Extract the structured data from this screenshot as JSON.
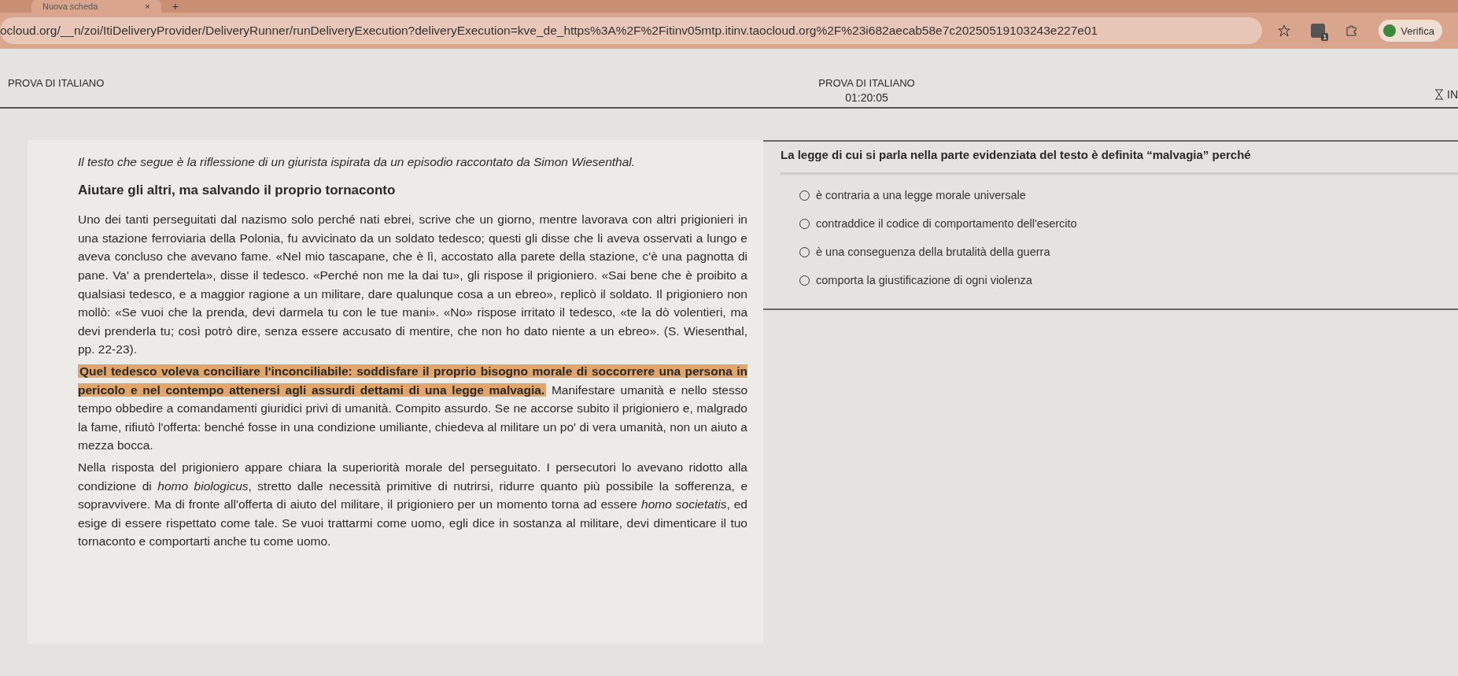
{
  "browser": {
    "tab_title": "Nuova scheda",
    "tab_close": "×",
    "new_tab": "+",
    "url": "ocloud.org/__n/zoi/ItiDeliveryProvider/DeliveryRunner/runDeliveryExecution?deliveryExecution=kve_de_https%3A%2F%2Fitinv05mtp.itinv.taocloud.org%2F%23i682aecab58e7c20250519103243e227e01",
    "extension_badge": "1",
    "verify_button": "Verifica"
  },
  "header": {
    "title": "PROVA DI ITALIANO",
    "test_name": "PROVA DI ITALIANO",
    "timer": "01:20:05",
    "user": "IN"
  },
  "passage": {
    "intro": "Il testo che segue è la riflessione di un giurista ispirata da un episodio raccontato da Simon Wiesenthal.",
    "heading": "Aiutare gli altri, ma salvando il proprio tornaconto",
    "paragraphs": [
      [
        {
          "text": "Uno dei tanti perseguitati dal nazismo solo perché nati ebrei, scrive che un giorno, mentre lavorava con altri prigionieri in una stazione ferroviaria della Polonia, fu avvicinato da un soldato tedesco; questi gli disse che li aveva osservati a lungo e aveva concluso che avevano fame. «Nel mio tascapane, che è lì, accostato alla parete della stazione, c'è una pagnotta di pane. Va' a prendertela», disse il tedesco. «Perché non me la dai tu», gli rispose il prigioniero. «Sai bene che è proibito a qualsiasi tedesco, e a maggior ragione a un militare, dare qualunque cosa a un ebreo», replicò il soldato. Il prigioniero non mollò: «Se vuoi che la prenda, devi darmela tu con le tue mani». «No» rispose irritato il tedesco, «te la dò volentieri, ma devi prenderla tu; così potrò dire, senza essere accusato di mentire, che non ho dato niente a un ebreo». (S. Wiesenthal, pp. 22-23).",
          "highlighted": false
        }
      ],
      [
        {
          "text": "Quel tedesco voleva conciliare l'inconciliabile: soddisfare il proprio bisogno morale di soccorrere una persona in pericolo e nel contempo attenersi agli assurdi dettami di una legge malvagia.",
          "highlighted": true
        },
        {
          "text": " Manifestare umanità e nello stesso tempo obbedire a comandamenti giuridici privi di umanità. Compito assurdo. Se ne accorse subito il prigioniero e, malgrado la fame, rifiutò l'offerta: benché fosse in una condizione umiliante, chiedeva al militare un po' di vera umanità, non un aiuto a mezza bocca.",
          "highlighted": false
        }
      ],
      [
        {
          "text": "Nella risposta del prigioniero appare chiara la superiorità morale del perseguitato. I persecutori lo avevano ridotto alla condizione di *homo biologicus*, stretto dalle necessità primitive di nutrirsi, ridurre quanto più possibile la sofferenza, e sopravvivere. Ma di fronte all'offerta di aiuto del militare, il prigioniero per un momento torna ad essere *homo societatis*, ed esige di essere rispettato come tale. Se vuoi trattarmi come uomo, egli dice in sostanza al militare, devi dimenticare il tuo tornaconto e comportarti anche tu come uomo.",
          "highlighted": false
        }
      ]
    ]
  },
  "question": {
    "prompt": "La legge di cui si parla nella parte evidenziata del testo è definita “malvagia” perché",
    "options": [
      {
        "label": "è contraria a una legge morale universale",
        "selected": false
      },
      {
        "label": "contraddice il codice di comportamento dell'esercito",
        "selected": false
      },
      {
        "label": "è una conseguenza della brutalità della guerra",
        "selected": false
      },
      {
        "label": "comporta la giustificazione di ogni violenza",
        "selected": false
      }
    ]
  }
}
